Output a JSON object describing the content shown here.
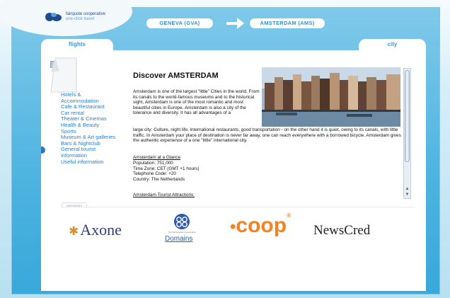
{
  "brand": {
    "line1": "fairquote cooperative",
    "line2": "one-click travel"
  },
  "route": {
    "from": "GENEVA (GVA)",
    "to": "AMSTERDAM (AMS)"
  },
  "tabs": {
    "flights": "flights",
    "city": "city"
  },
  "nav": {
    "items": [
      "Hotels &",
      "Accommodation",
      "Cafe & Restaurant",
      "Car rental",
      "Theater & Cinemas",
      "Health & Beauty",
      "Sports",
      "Museum & Art galleries",
      "Bars & Nightclub",
      "General tourist",
      "information",
      "Useful information"
    ]
  },
  "article": {
    "title": "Discover AMSTERDAM",
    "intro": "Amsterdam is one of the largest \"little\" Cities in the world. From its canals to the world-famous museums and to the historical sight, Amsterdam is one of the most romantic and most beautiful cities in Europe. Amsterdam is also a city of the tolerance and diversity. It has all advantages of a",
    "continuation": "large city: Culture, night life, international restaurants, good transportation - on the other hand it is quiet, owing to its canals, with little traffic. In Amsterdam your place of destination is never far away, one can reach everywhere with a borrowed bicycle. Amsterdam gives the authentic experience of a one \"little\" international city.",
    "glance_heading": "Amsterdam at a Glance",
    "population": "Population: 751,000",
    "time_zone": "Time Zone: CET (GMT +1 hours)",
    "telephone": "Telephone Code: +20",
    "country": "Country: The Netherlands",
    "attractions_heading": "Amsterdam-Tourist Attractions:"
  },
  "ads": {
    "tag": "advertising",
    "axone": "Axone",
    "domains_sub": "The Netherlands Cooperative",
    "domains": "Domains",
    "coop": "coop",
    "newscred": "NewsCred"
  },
  "colors": {
    "accent": "#3a9ad6",
    "link": "#2a7fc7",
    "coop": "#f58220",
    "frame": "#4db3e0"
  },
  "icons": {
    "flag": "uk-flag-icon",
    "arrow": "right-arrow-icon"
  }
}
